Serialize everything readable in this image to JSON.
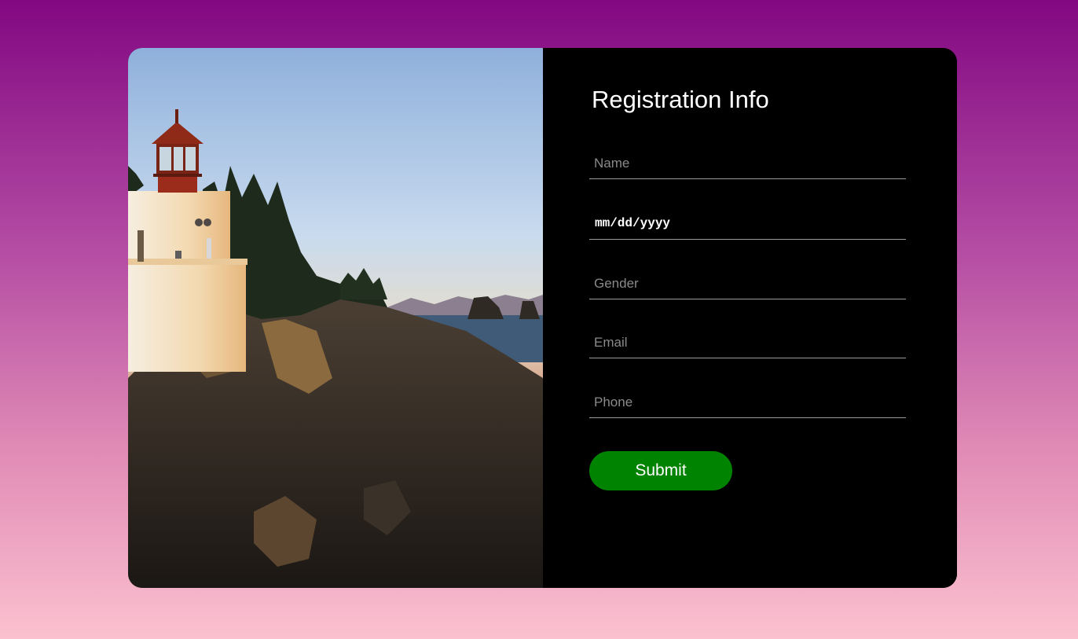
{
  "form": {
    "title": "Registration Info",
    "name_placeholder": "Name",
    "dob_placeholder": "mm/dd/yyyy",
    "gender_placeholder": "Gender",
    "email_placeholder": "Email",
    "phone_placeholder": "Phone",
    "submit_label": "Submit"
  },
  "colors": {
    "background_top": "#820882",
    "background_bottom": "#fbc1cf",
    "panel": "#000000",
    "submit": "#008300"
  }
}
